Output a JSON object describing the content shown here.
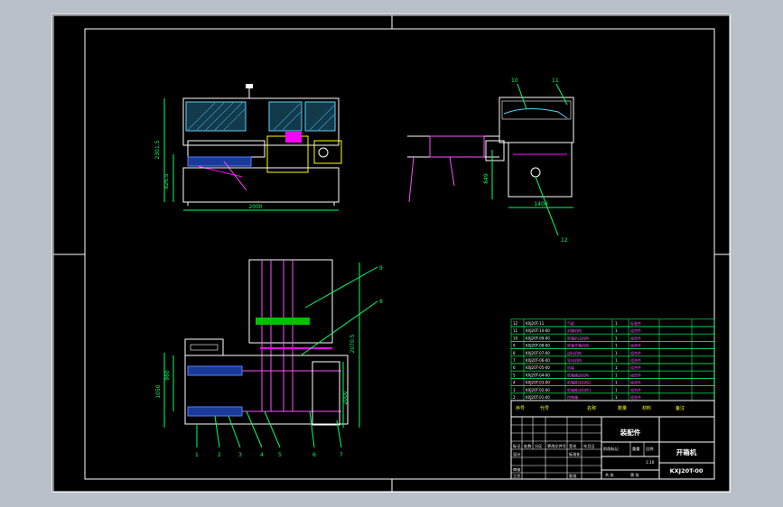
{
  "drawing": {
    "front_view": {
      "dim_width": "2000",
      "dim_height_total": "2301.5",
      "dim_height_table": "826.5"
    },
    "side_view": {
      "dim_width": "1400",
      "dim_height": "849",
      "balloons": [
        "10",
        "11",
        "12"
      ]
    },
    "top_view": {
      "dim_right": "2070.5",
      "dim_left": "1050",
      "dim_left2": "960",
      "dim_mid": "2000",
      "balloons_top": [
        "9",
        "8"
      ],
      "balloons_bottom": [
        "1",
        "2",
        "3",
        "4",
        "5",
        "6",
        "7"
      ]
    },
    "bom": {
      "rows": [
        {
          "no": "12",
          "code": "KXJ20T-11",
          "name": "气缸",
          "qty": "1",
          "mat": "标准件"
        },
        {
          "no": "11",
          "code": "KXJ20T-10-00",
          "name": "封箱机构",
          "qty": "1",
          "mat": "组合件"
        },
        {
          "no": "10",
          "code": "KXJ20T-09-00",
          "name": "纸箱折边机构",
          "qty": "1",
          "mat": "组合件"
        },
        {
          "no": "9",
          "code": "KXJ20T-08-00",
          "name": "纸箱开箱机构",
          "qty": "1",
          "mat": "组合件"
        },
        {
          "no": "8",
          "code": "KXJ20T-07-00",
          "name": "送料机构",
          "qty": "1",
          "mat": "组合件"
        },
        {
          "no": "7",
          "code": "KXJ20T-06-00",
          "name": "导向机构",
          "qty": "1",
          "mat": "组合件"
        },
        {
          "no": "6",
          "code": "KXJ20T-05-00",
          "name": "机架",
          "qty": "1",
          "mat": "组合件"
        },
        {
          "no": "5",
          "code": "KXJ20T-04-00",
          "name": "纸箱输送机构",
          "qty": "1",
          "mat": "组合件"
        },
        {
          "no": "4",
          "code": "KXJ20T-03-00",
          "name": "纸箱推送机构2",
          "qty": "1",
          "mat": "组合件"
        },
        {
          "no": "3",
          "code": "KXJ20T-02-00",
          "name": "纸箱推送机构1",
          "qty": "1",
          "mat": "组合件"
        },
        {
          "no": "2",
          "code": "KXJ20T-01-00",
          "name": "控制箱",
          "qty": "1",
          "mat": "组合件"
        }
      ],
      "header": {
        "no": "序号",
        "code": "代号",
        "name": "名称",
        "qty": "数量",
        "mat": "材料",
        "remark": "备注"
      }
    },
    "title_block": {
      "drawing_type": "装配件",
      "machine_name": "开箱机",
      "drawing_number": "KXJ20T-00",
      "scale": "1:10",
      "labels": {
        "mark": "标记",
        "count": "处数",
        "zone": "分区",
        "change_doc": "更改文件号",
        "signature": "签名",
        "date": "年月日",
        "design": "设计",
        "standardize": "标准化",
        "review": "审核",
        "process": "工艺",
        "approve": "批准",
        "stage_mark": "阶段标记",
        "weight": "重量",
        "ratio": "比例",
        "sheet_total": "共 张",
        "sheet_no": "第 张"
      }
    }
  }
}
